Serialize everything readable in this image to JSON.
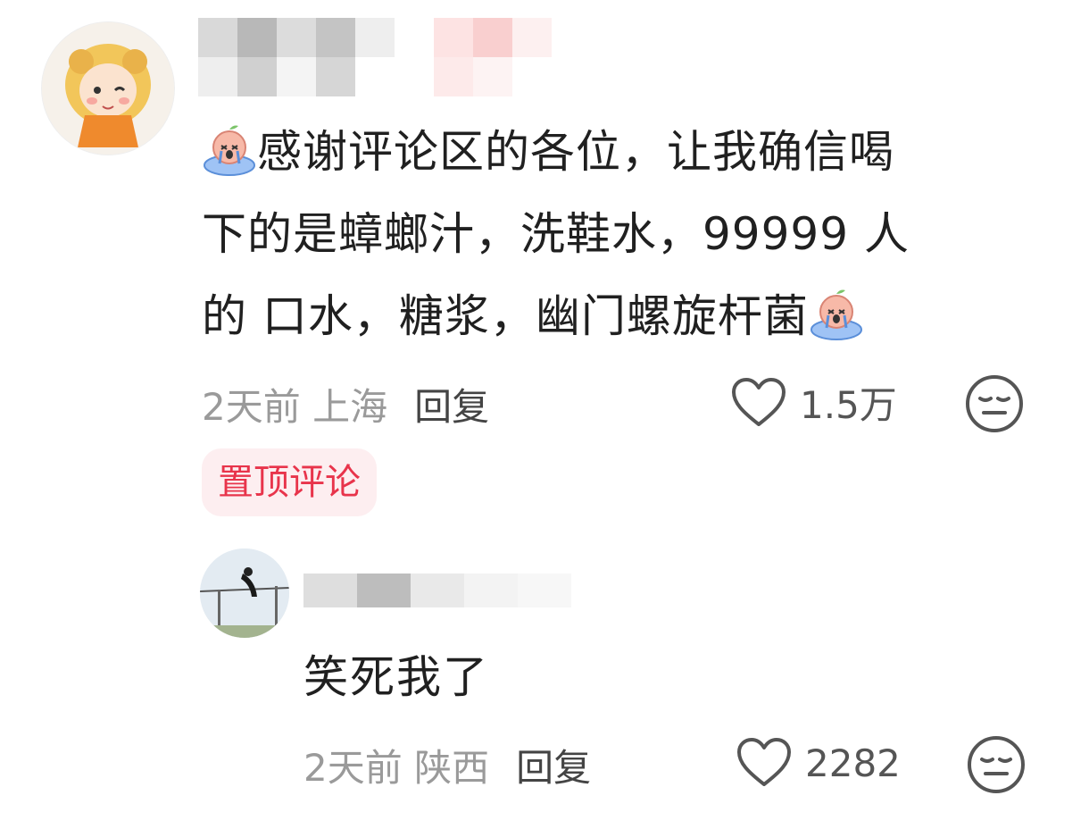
{
  "main_comment": {
    "text_line1": "感谢评论区的各位，让我确信喝",
    "text_line2": "下的是蟑螂汁，洗鞋水，99999 人",
    "text_line3": "的 口水，糖浆，幽门螺旋杆菌",
    "time_location": "2天前 上海",
    "reply_label": "回复",
    "likes": "1.5万",
    "pinned_label": "置顶评论"
  },
  "reply_comment": {
    "text": "笑死我了",
    "time_location": "2天前 陕西",
    "reply_label": "回复",
    "likes": "2282"
  },
  "colors": {
    "pinned_bg": "#fdeef0",
    "pinned_text": "#e8344b",
    "meta_text": "#9a9a9a"
  },
  "icons": [
    "heart-outline-icon",
    "dislike-face-icon",
    "crying-emoji-icon"
  ]
}
